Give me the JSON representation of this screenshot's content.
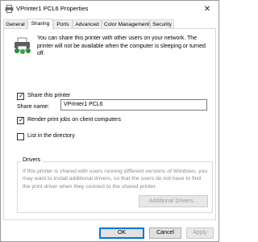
{
  "window": {
    "title": "VPrinter1 PCL6 Properties",
    "close_glyph": "✕"
  },
  "tabs": [
    {
      "label": "General"
    },
    {
      "label": "Sharing"
    },
    {
      "label": "Ports"
    },
    {
      "label": "Advanced"
    },
    {
      "label": "Color Management"
    },
    {
      "label": "Security"
    }
  ],
  "active_tab": "Sharing",
  "sharing": {
    "info_text": "You can share this printer with other users on your network. The printer will not be available when the computer is sleeping or turned off.",
    "share_checkbox": {
      "label": "Share this printer",
      "checked": true
    },
    "share_name": {
      "label": "Share name:",
      "value": "VPrinter1 PCL6"
    },
    "render_checkbox": {
      "label": "Render print jobs on client computers",
      "checked": true
    },
    "directory_checkbox": {
      "label": "List in the directory",
      "checked": false
    },
    "drivers": {
      "title": "Drivers",
      "text": "If this printer is shared with users running different versions of Windows, you may want to install additional drivers, so that the users do not have to find the print driver when they connect to the shared printer.",
      "button_label": "Additional Drivers..."
    }
  },
  "footer": {
    "ok_label": "OK",
    "cancel_label": "Cancel",
    "apply_label": "Apply"
  },
  "colors": {
    "accent": "#0078d7",
    "disabled_text": "#9c9c9c"
  },
  "icons": [
    "printer-icon",
    "close-icon",
    "shared-printer-icon",
    "checkmark-icon"
  ]
}
